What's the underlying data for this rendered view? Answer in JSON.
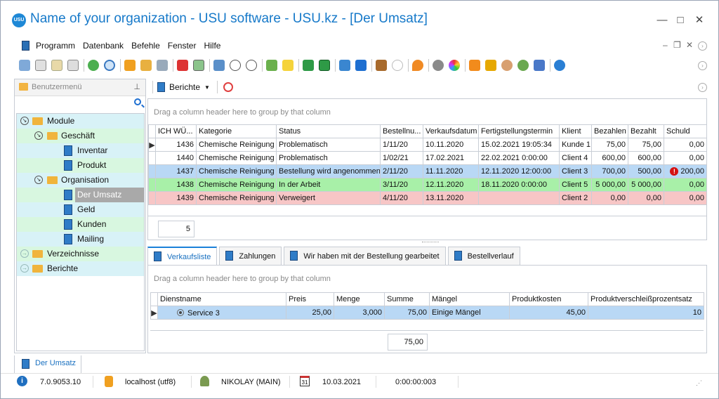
{
  "window": {
    "title": "Name of your organization - USU software - USU.kz - [Der Umsatz]",
    "logo_text": "USU",
    "min_icon": "minimize-icon",
    "max_icon": "maximize-icon",
    "close_icon": "close-icon"
  },
  "menu": [
    "Programm",
    "Datenbank",
    "Befehle",
    "Fenster",
    "Hilfe"
  ],
  "colors": {
    "accent": "#1679c9",
    "row_blue": "#b9d8f5",
    "row_green": "#a8f0a8",
    "row_pink": "#f7c6c6",
    "folder": "#f0b43c"
  },
  "sidebar": {
    "title": "Benutzermenü",
    "items": [
      {
        "label": "Module"
      },
      {
        "label": "Geschäft"
      },
      {
        "label": "Inventar"
      },
      {
        "label": "Produkt"
      },
      {
        "label": "Organisation"
      },
      {
        "label": "Der Umsatz"
      },
      {
        "label": "Geld"
      },
      {
        "label": "Kunden"
      },
      {
        "label": "Mailing"
      },
      {
        "label": "Verzeichnisse"
      },
      {
        "label": "Berichte"
      }
    ]
  },
  "reports_button": "Berichte",
  "main_grid": {
    "group_hint": "Drag a column header here to group by that column",
    "columns": [
      "ICH WÜ...",
      "Kategorie",
      "Status",
      "Bestellnu...",
      "Verkaufsdatum",
      "Fertigstellungstermin",
      "Klient",
      "Bezahlen",
      "Bezahlt",
      "Schuld"
    ],
    "rows": [
      [
        "1436",
        "Chemische Reinigung",
        "Problematisch",
        "1/11/20",
        "10.11.2020",
        "15.02.2021 19:05:34",
        "Kunde 1",
        "75,00",
        "75,00",
        "0,00"
      ],
      [
        "1440",
        "Chemische Reinigung",
        "Problematisch",
        "1/02/21",
        "17.02.2021",
        "22.02.2021 0:00:00",
        "Client 4",
        "600,00",
        "600,00",
        "0,00"
      ],
      [
        "1437",
        "Chemische Reinigung",
        "Bestellung wird angenommen",
        "2/11/20",
        "11.11.2020",
        "12.11.2020 12:00:00",
        "Client 3",
        "700,00",
        "500,00",
        "200,00"
      ],
      [
        "1438",
        "Chemische Reinigung",
        "In der Arbeit",
        "3/11/20",
        "12.11.2020",
        "18.11.2020 0:00:00",
        "Client 5",
        "5 000,00",
        "5 000,00",
        "0,00"
      ],
      [
        "1439",
        "Chemische Reinigung",
        "Verweigert",
        "4/11/20",
        "13.11.2020",
        "",
        "Client 2",
        "0,00",
        "0,00",
        "0,00"
      ]
    ],
    "count": "5"
  },
  "tabs": [
    "Verkaufsliste",
    "Zahlungen",
    "Wir haben mit der Bestellung gearbeitet",
    "Bestellverlauf"
  ],
  "sub_grid": {
    "group_hint": "Drag a column header here to group by that column",
    "columns": [
      "Dienstname",
      "Preis",
      "Menge",
      "Summe",
      "Mängel",
      "Produktkosten",
      "Produktverschleißprozentsatz"
    ],
    "rows": [
      [
        "Service 3",
        "25,00",
        "3,000",
        "75,00",
        "Einige Mängel",
        "45,00",
        "10"
      ]
    ],
    "total": "75,00"
  },
  "bottom_tab": "Der Umsatz",
  "statusbar": {
    "version": "7.0.9053.10",
    "db": "localhost (utf8)",
    "user": "NIKOLAY (MAIN)",
    "date": "10.03.2021",
    "calendar_day": "31",
    "timer": "0:00:00:003"
  }
}
